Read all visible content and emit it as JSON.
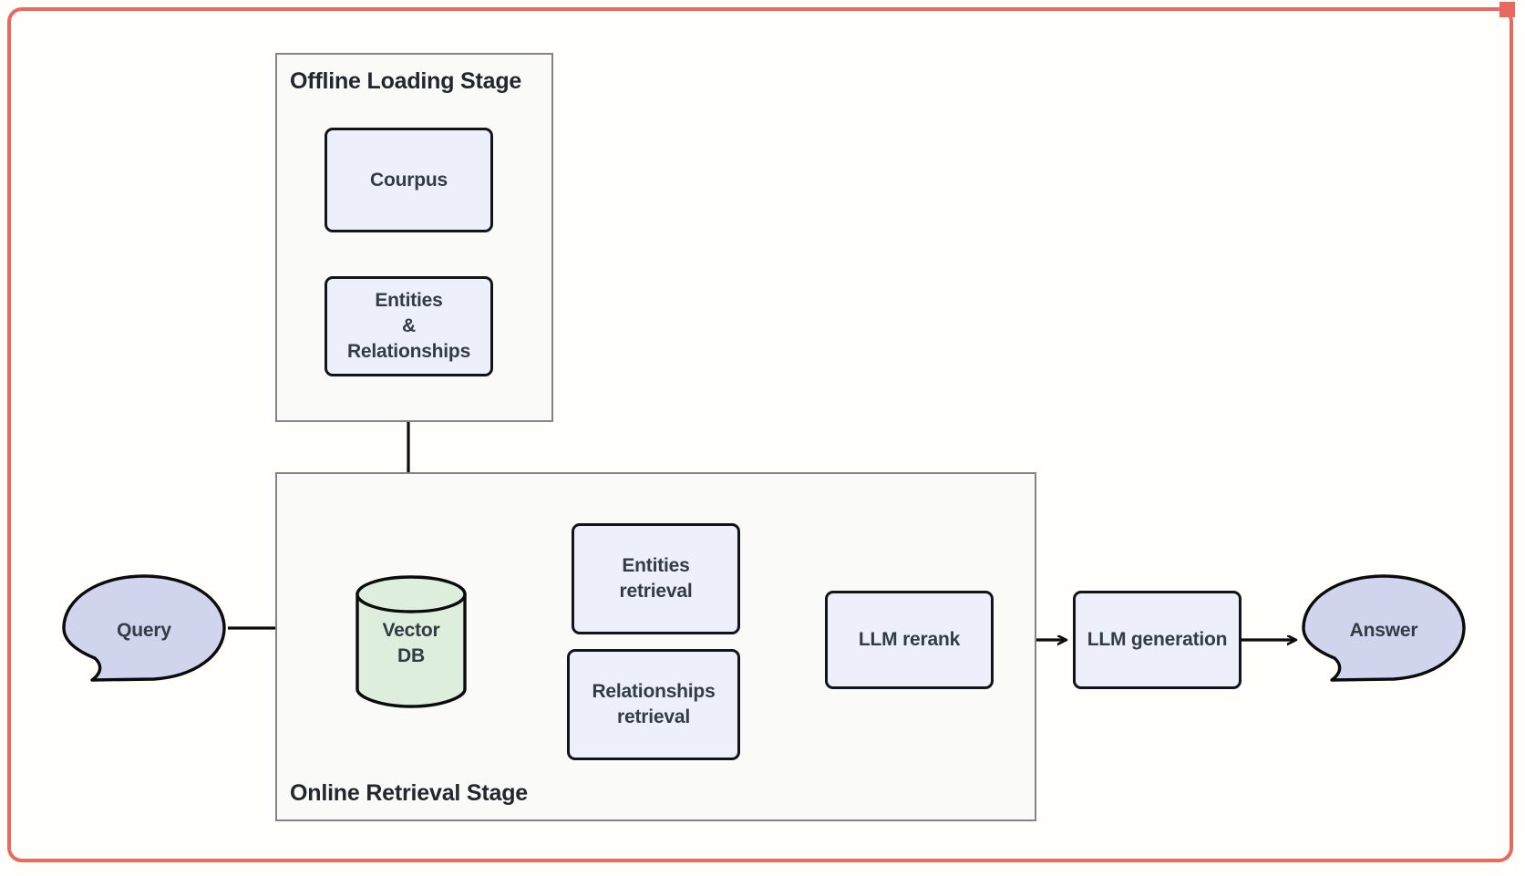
{
  "frame": {
    "border_color": "#e8695f",
    "handle_name": "resize-handle"
  },
  "colors": {
    "node_fill": "#edf0fa",
    "node_stroke": "#131417",
    "bubble_fill": "#d0d4ec",
    "cylinder_fill": "#ddeedd",
    "stage_fill": "#fafaf8",
    "stage_stroke": "#848484",
    "text": "#333b44",
    "frame": "#e8695f"
  },
  "stages": {
    "offline": {
      "title": "Offline Loading Stage"
    },
    "online": {
      "title": "Online Retrieval Stage"
    }
  },
  "nodes": {
    "corpus": {
      "label": "Courpus"
    },
    "entities_relationships": {
      "line1": "Entities",
      "line2": "&",
      "line3": "Relationships"
    },
    "query": {
      "label": "Query"
    },
    "vector_db": {
      "line1": "Vector",
      "line2": "DB"
    },
    "entities_retrieval": {
      "line1": "Entities",
      "line2": "retrieval"
    },
    "relationships_retrieval": {
      "line1": "Relationships",
      "line2": "retrieval"
    },
    "llm_rerank": {
      "label": "LLM rerank"
    },
    "llm_generation": {
      "label": "LLM generation"
    },
    "answer": {
      "label": "Answer"
    }
  },
  "edges": [
    {
      "name": "corpus-to-entities",
      "from": "corpus",
      "to": "entities_relationships"
    },
    {
      "name": "entities-to-vectordb",
      "from": "entities_relationships",
      "to": "vector_db"
    },
    {
      "name": "query-to-vectordb",
      "from": "query",
      "to": "vector_db"
    },
    {
      "name": "vectordb-to-entities-retrieval",
      "from": "vector_db",
      "to": "entities_retrieval"
    },
    {
      "name": "vectordb-to-relationships-retrieval",
      "from": "vector_db",
      "to": "relationships_retrieval"
    },
    {
      "name": "entities-retrieval-to-rerank",
      "from": "entities_retrieval",
      "to": "llm_rerank"
    },
    {
      "name": "relationships-retrieval-to-rerank",
      "from": "relationships_retrieval",
      "to": "llm_rerank"
    },
    {
      "name": "rerank-to-generation",
      "from": "llm_rerank",
      "to": "llm_generation"
    },
    {
      "name": "generation-to-answer",
      "from": "llm_generation",
      "to": "answer"
    }
  ]
}
